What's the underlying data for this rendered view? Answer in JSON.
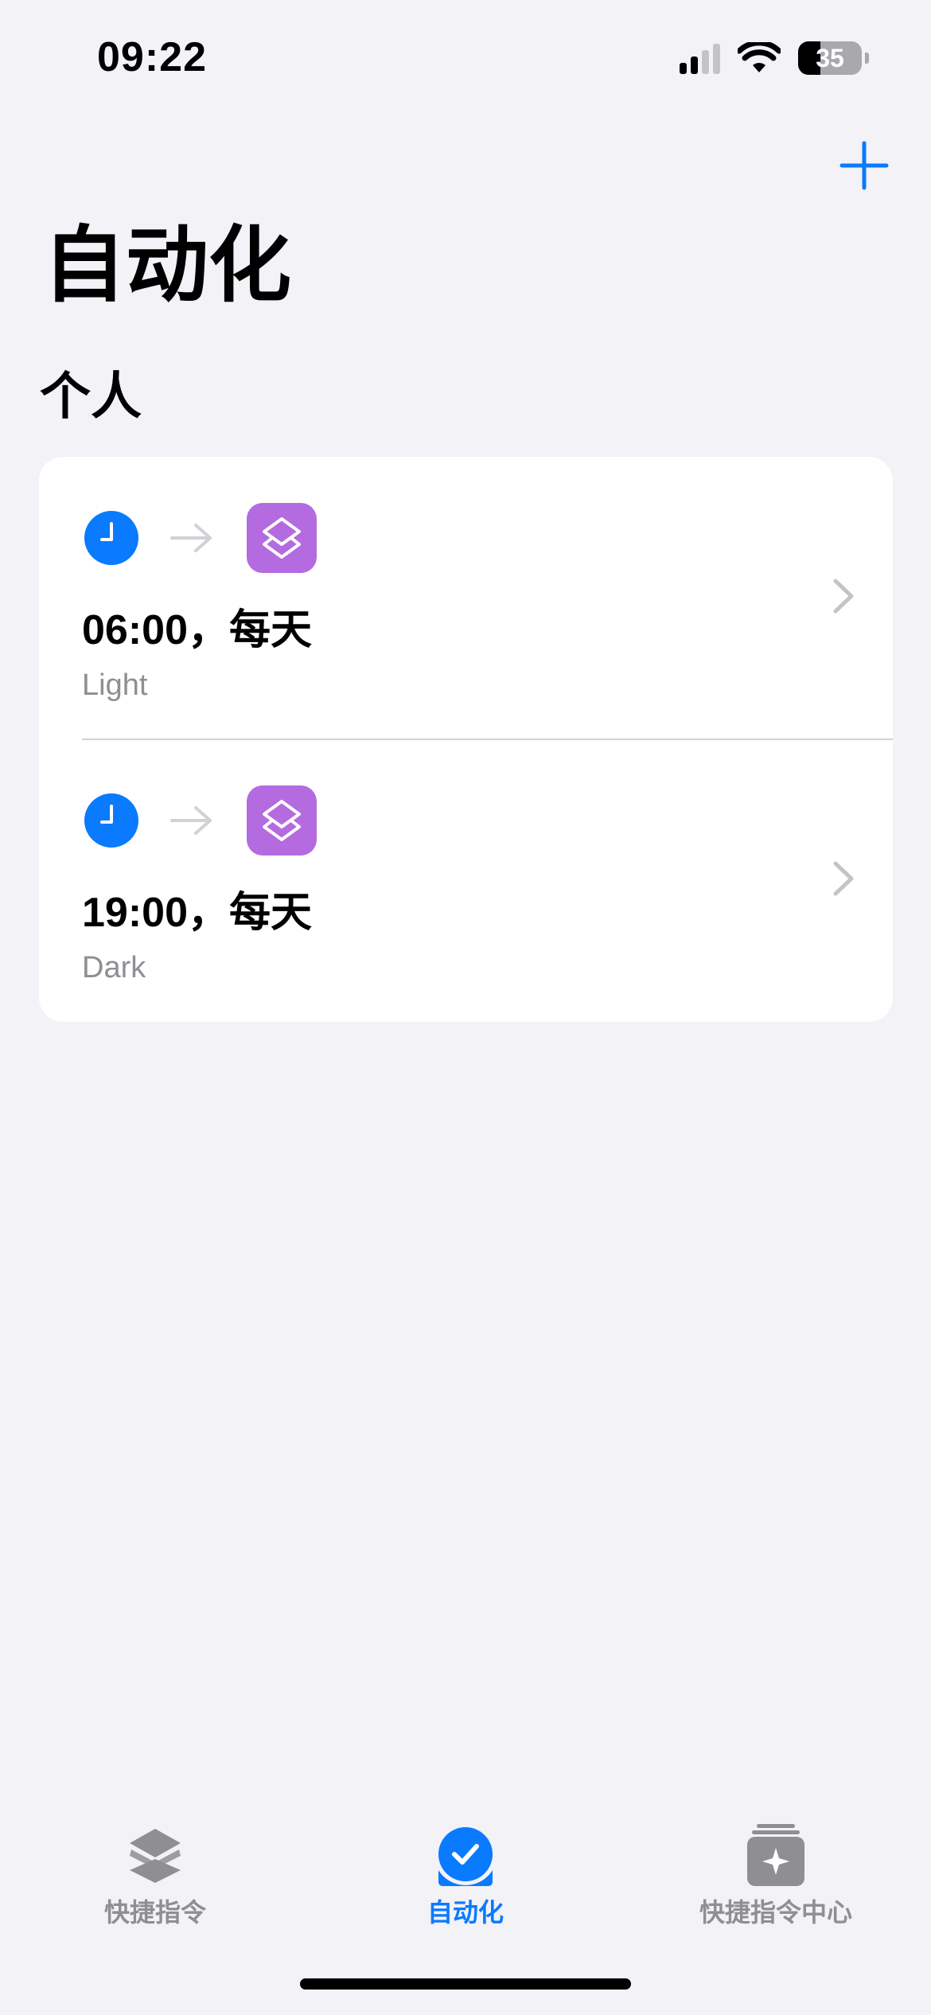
{
  "status_bar": {
    "time": "09:22",
    "battery_level": "35"
  },
  "header": {
    "add_label": "+",
    "title": "自动化"
  },
  "section": {
    "title": "个人"
  },
  "automations": [
    {
      "title": "06:00，每天",
      "subtitle": "Light"
    },
    {
      "title": "19:00，每天",
      "subtitle": "Dark"
    }
  ],
  "tab_bar": {
    "items": [
      {
        "label": "快捷指令",
        "icon": "layers-icon",
        "active": false
      },
      {
        "label": "自动化",
        "icon": "automation-check-icon",
        "active": true
      },
      {
        "label": "快捷指令中心",
        "icon": "gallery-sparkle-icon",
        "active": false
      }
    ]
  },
  "colors": {
    "accent": "#0a7aff",
    "background": "#f2f2f7",
    "shortcut_icon": "#b46bdf",
    "secondary_text": "#8e8e93"
  }
}
